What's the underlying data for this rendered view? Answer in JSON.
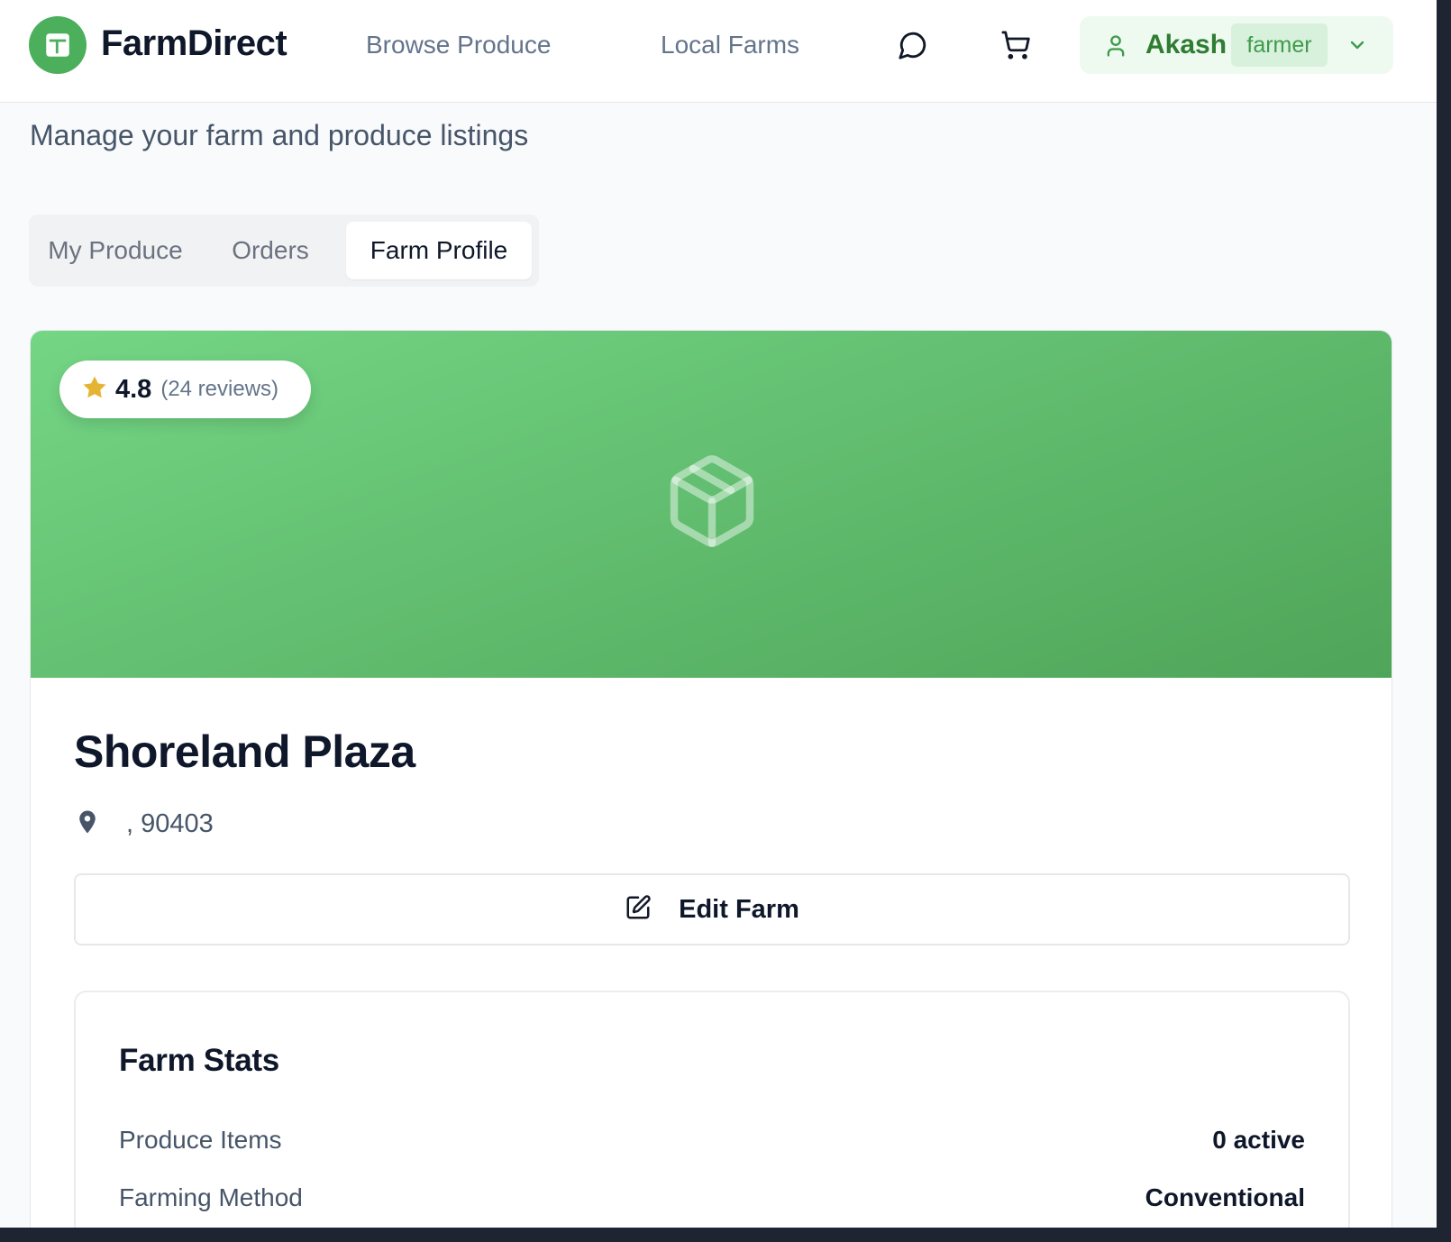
{
  "brand": {
    "name": "FarmDirect",
    "color": "#4caf5c"
  },
  "nav": {
    "browse_label": "Browse Produce",
    "farms_label": "Local Farms",
    "chat_icon": "message-circle-icon",
    "cart_icon": "shopping-cart-icon"
  },
  "user": {
    "name": "Akash",
    "role": "farmer"
  },
  "page": {
    "subtitle": "Manage your farm and produce listings"
  },
  "tabs": [
    {
      "label": "My Produce",
      "active": false
    },
    {
      "label": "Orders",
      "active": false
    },
    {
      "label": "Farm Profile",
      "active": true
    }
  ],
  "farm": {
    "rating": "4.8",
    "reviews": "(24 reviews)",
    "name": "Shoreland Plaza",
    "location": ", 90403",
    "edit_label": "Edit Farm",
    "hero_icon": "package-icon"
  },
  "stats": {
    "title": "Farm Stats",
    "rows": [
      {
        "label": "Produce Items",
        "value": "0 active"
      },
      {
        "label": "Farming Method",
        "value": "Conventional"
      }
    ]
  }
}
